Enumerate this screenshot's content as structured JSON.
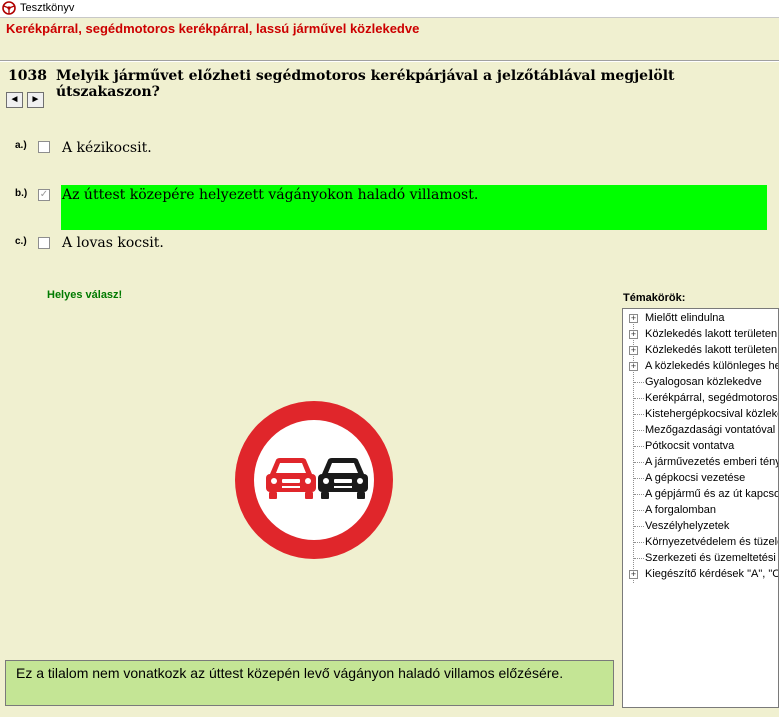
{
  "window": {
    "title": "Tesztkönyv"
  },
  "category": "Kerékpárral, segédmotoros kerékpárral, lassú járművel közlekedve",
  "question": {
    "number": "1038",
    "text": "Melyik járművet előzheti segédmotoros kerékpárjával a jelzőtáblával megjelölt útszakaszon?",
    "prev_label": "◄",
    "next_label": "►"
  },
  "answers": [
    {
      "label": "a.)",
      "text": "A kézikocsit.",
      "checked": false
    },
    {
      "label": "b.)",
      "text": "Az úttest közepére helyezett vágányokon haladó villamost.",
      "checked": true,
      "correct": true
    },
    {
      "label": "c.)",
      "text": "A lovas kocsit.",
      "checked": false
    }
  ],
  "result_text": "Helyes válasz!",
  "sign": {
    "icon": "no-overtaking-sign-icon",
    "ring_color": "#e0262b",
    "left_car_color": "#e0262b",
    "right_car_color": "#1a1a1a"
  },
  "explanation": "Ez a tilalom nem vonatkozk az úttest közepén levő vágányon haladó villamos előzésére.",
  "topics": {
    "label": "Témakörök:",
    "items": [
      {
        "text": "Mielőtt elindulna",
        "expandable": true
      },
      {
        "text": "Közlekedés lakott területen",
        "expandable": true
      },
      {
        "text": "Közlekedés lakott területen k",
        "expandable": true
      },
      {
        "text": "A közlekedés különleges he",
        "expandable": true
      },
      {
        "text": "Gyalogosan közlekedve",
        "expandable": false
      },
      {
        "text": "Kerékpárral, segédmotoros k",
        "expandable": false
      },
      {
        "text": "Kistehergépkocsival közleke",
        "expandable": false
      },
      {
        "text": "Mezőgazdasági vontatóval k",
        "expandable": false
      },
      {
        "text": "Pótkocsit vontatva",
        "expandable": false
      },
      {
        "text": "A járművezetés emberi tényez",
        "expandable": false
      },
      {
        "text": "A gépkocsi vezetése",
        "expandable": false
      },
      {
        "text": "A gépjármű és az út kapcsol",
        "expandable": false
      },
      {
        "text": "A forgalomban",
        "expandable": false
      },
      {
        "text": "Veszélyhelyzetek",
        "expandable": false
      },
      {
        "text": "Környezetvédelem és tüzelőa",
        "expandable": false
      },
      {
        "text": "Szerkezeti és üzemeltetési is",
        "expandable": false
      },
      {
        "text": "Kiegészítő kérdések \"A\", \"C",
        "expandable": true
      }
    ]
  },
  "colors": {
    "background": "#f0f0d0",
    "category": "#cc0000",
    "correct_highlight": "#00ff00",
    "result": "#007a00",
    "explanation_bg": "#c4e595"
  }
}
